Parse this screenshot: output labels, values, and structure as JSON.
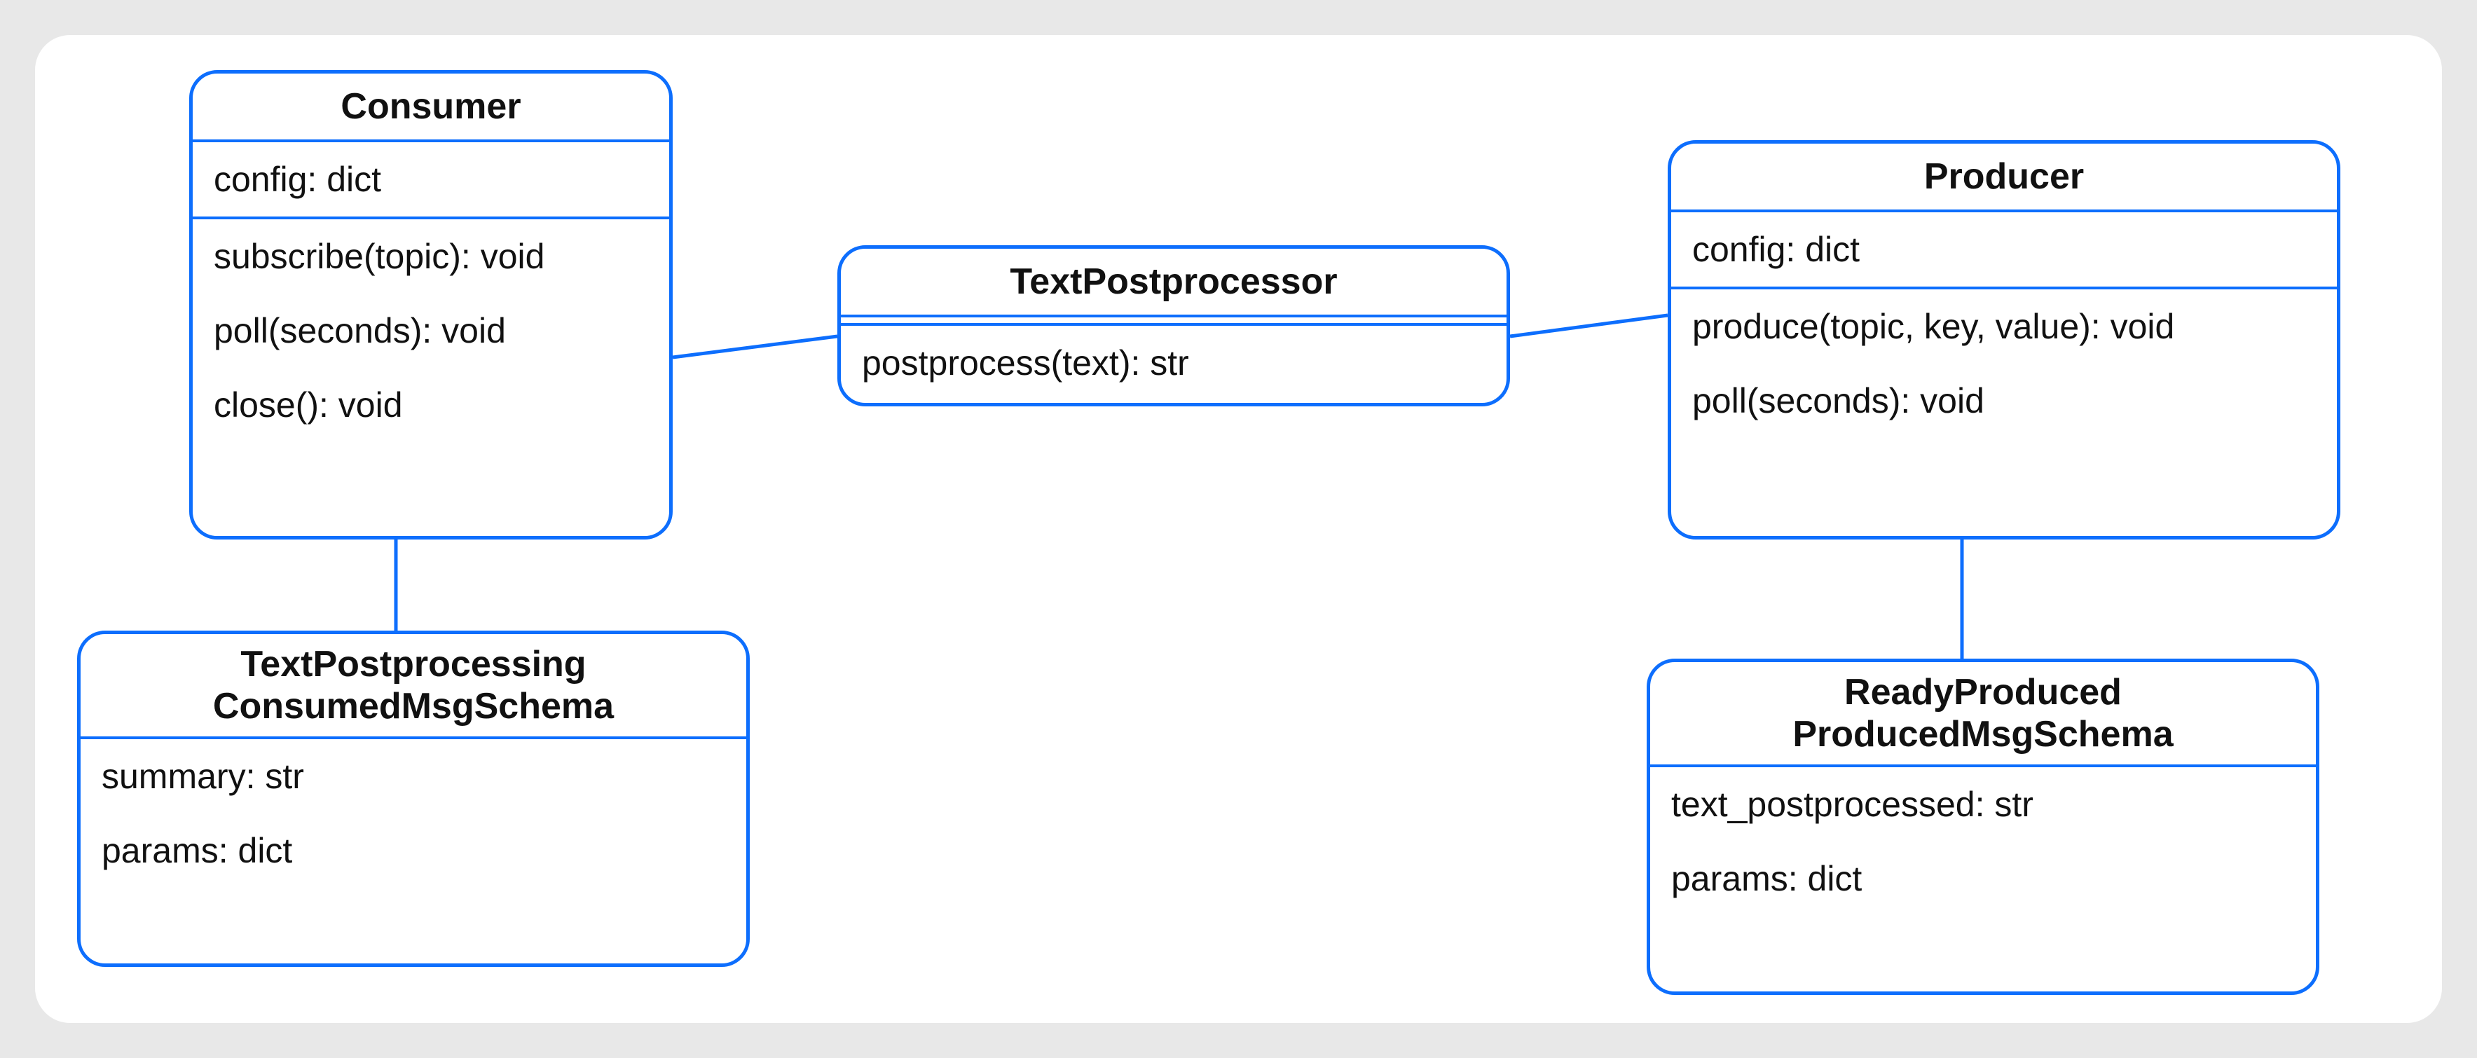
{
  "colors": {
    "accent": "#0d6efd",
    "bg_page": "#e8e8e8",
    "bg_canvas": "#ffffff"
  },
  "classes": {
    "consumer": {
      "name": "Consumer",
      "attrs": [
        "config: dict"
      ],
      "methods": [
        "subscribe(topic): void",
        "poll(seconds): void",
        "close(): void"
      ]
    },
    "textpost": {
      "name": "TextPostprocessor",
      "methods": [
        "postprocess(text): str"
      ]
    },
    "producer": {
      "name": "Producer",
      "attrs": [
        "config: dict"
      ],
      "methods": [
        "produce(topic, key, value): void",
        "poll(seconds): void"
      ]
    },
    "consumed_schema": {
      "name_l1": "TextPostprocessing",
      "name_l2": "ConsumedMsgSchema",
      "attrs": [
        "summary: str",
        "params: dict"
      ]
    },
    "produced_schema": {
      "name_l1": "ReadyProduced",
      "name_l2": "ProducedMsgSchema",
      "attrs": [
        "text_postprocessed: str",
        "params: dict"
      ]
    }
  },
  "associations": [
    {
      "from": "consumer",
      "to": "textpost"
    },
    {
      "from": "textpost",
      "to": "producer"
    },
    {
      "from": "consumer",
      "to": "consumed_schema"
    },
    {
      "from": "producer",
      "to": "produced_schema"
    }
  ]
}
